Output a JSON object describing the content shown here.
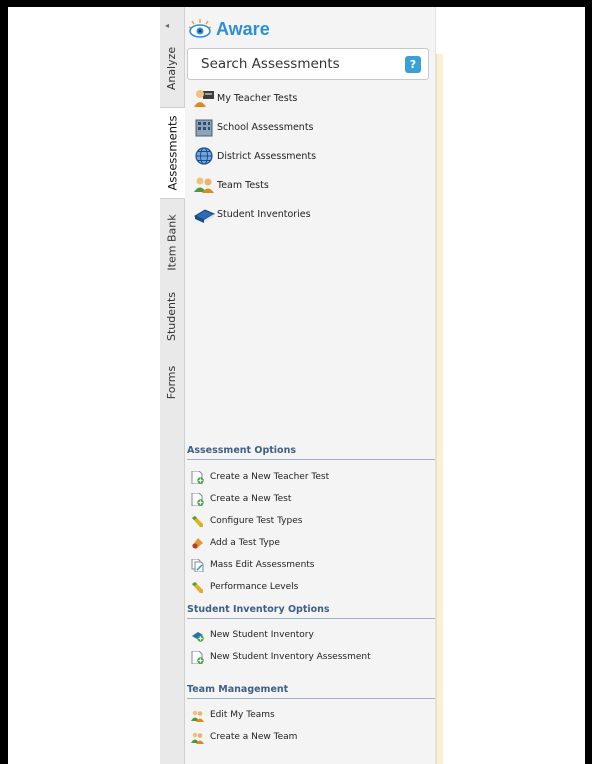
{
  "app": {
    "logo_text": "Aware"
  },
  "tabs": [
    {
      "label": "Analyze"
    },
    {
      "label": "Assessments"
    },
    {
      "label": "Item Bank"
    },
    {
      "label": "Students"
    },
    {
      "label": "Forms"
    }
  ],
  "search": {
    "placeholder": "Search Assessments",
    "help_label": "?"
  },
  "nav": {
    "items": [
      {
        "label": "My Teacher Tests",
        "icon": "teacher-icon"
      },
      {
        "label": "School Assessments",
        "icon": "school-building-icon"
      },
      {
        "label": "District Assessments",
        "icon": "globe-icon"
      },
      {
        "label": "Team Tests",
        "icon": "team-icon"
      },
      {
        "label": "Student Inventories",
        "icon": "book-icon"
      }
    ]
  },
  "assessment_options": {
    "heading": "Assessment Options",
    "items": [
      {
        "label": "Create a New Teacher Test",
        "icon": "new-document-icon"
      },
      {
        "label": "Create a New Test",
        "icon": "new-document-icon"
      },
      {
        "label": "Configure Test Types",
        "icon": "pencil-icon"
      },
      {
        "label": "Add a Test Type",
        "icon": "add-type-icon"
      },
      {
        "label": "Mass Edit Assessments",
        "icon": "edit-documents-icon"
      },
      {
        "label": "Performance Levels",
        "icon": "pencil-icon"
      }
    ]
  },
  "student_inventory_options": {
    "heading": "Student Inventory Options",
    "items": [
      {
        "label": "New Student Inventory",
        "icon": "new-inventory-icon"
      },
      {
        "label": "New Student Inventory Assessment",
        "icon": "new-document-icon"
      }
    ]
  },
  "team_management": {
    "heading": "Team Management",
    "items": [
      {
        "label": "Edit My Teams",
        "icon": "team-icon"
      },
      {
        "label": "Create a New Team",
        "icon": "team-icon"
      }
    ]
  },
  "colors": {
    "accent": "#2d8fd8",
    "section_heading": "#3f5f85",
    "help_button": "#3aa0d8"
  }
}
